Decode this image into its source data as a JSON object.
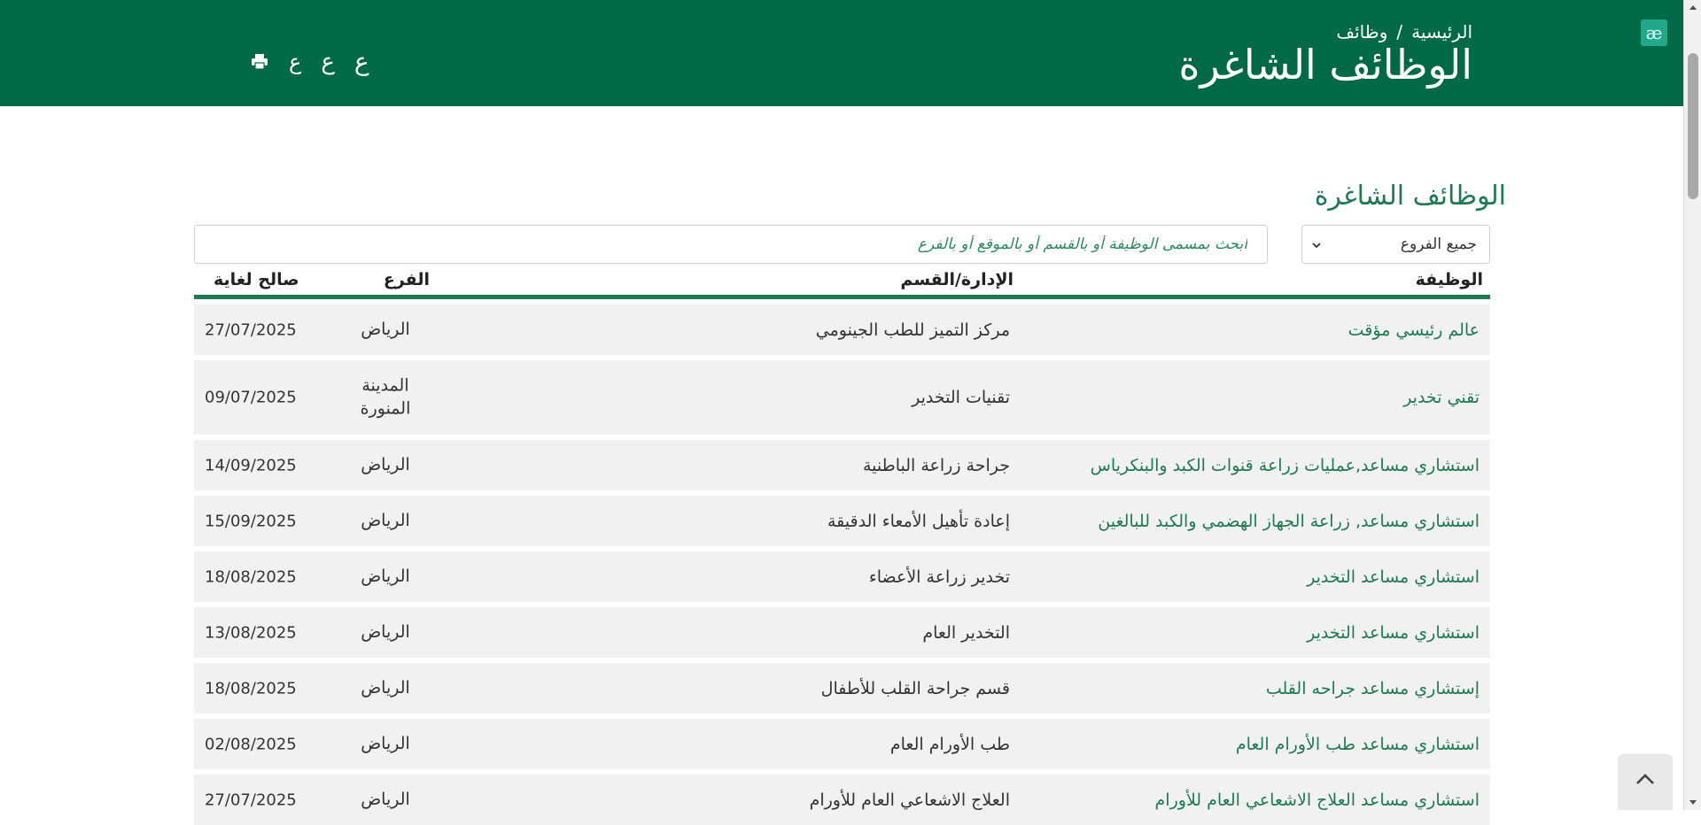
{
  "header": {
    "breadcrumb": {
      "home": "الرئيسية",
      "separator": "/",
      "current": "وظائف"
    },
    "title": "الوظائف الشاغرة",
    "accessibility_glyph": "æ",
    "font_controls": {
      "small": "ع",
      "medium": "ع",
      "large": "ع"
    },
    "bg_color": "#006a47"
  },
  "main": {
    "section_title": "الوظائف الشاغرة",
    "filters": {
      "branch_selected": "جميع الفروع",
      "search_placeholder": "ابحث بمسمى الوظيفة أو بالقسم أو بالموقع أو بالفرع"
    },
    "table": {
      "headers": {
        "job": "الوظيفة",
        "department": "الإدارة/القسم",
        "branch": "الفرع",
        "valid_until": "صالح لغاية"
      },
      "rows": [
        {
          "job": "عالم رئيسي مؤقت",
          "department": "مركز التميز للطب الجينومي",
          "branch": "الرياض",
          "valid_until": "27/07/2025"
        },
        {
          "job": "تقني تخدير",
          "department": "تقنيات التخدير",
          "branch": "المدينة المنورة",
          "valid_until": "09/07/2025"
        },
        {
          "job": "استشاري مساعد,عمليات زراعة قنوات الكبد والبنكرياس",
          "department": "جراحة زراعة الباطنية",
          "branch": "الرياض",
          "valid_until": "14/09/2025"
        },
        {
          "job": "استشاري مساعد, زراعة الجهاز الهضمي والكبد للبالغين",
          "department": "إعادة تأهيل الأمعاء الدقيقة",
          "branch": "الرياض",
          "valid_until": "15/09/2025"
        },
        {
          "job": "استشاري مساعد التخدير",
          "department": "تخدير زراعة الأعضاء",
          "branch": "الرياض",
          "valid_until": "18/08/2025"
        },
        {
          "job": "استشاري مساعد التخدير",
          "department": "التخدير العام",
          "branch": "الرياض",
          "valid_until": "13/08/2025"
        },
        {
          "job": "إستشاري مساعد جراحه القلب",
          "department": "قسم جراحة القلب للأطفال",
          "branch": "الرياض",
          "valid_until": "18/08/2025"
        },
        {
          "job": "استشاري مساعد طب الأورام العام",
          "department": "طب الأورام العام",
          "branch": "الرياض",
          "valid_until": "02/08/2025"
        },
        {
          "job": "استشاري مساعد العلاج الاشعاعي العام للأورام",
          "department": "العلاج الاشعاعي العام للأورام",
          "branch": "الرياض",
          "valid_until": "27/07/2025"
        }
      ]
    }
  },
  "colors": {
    "brand_green": "#006a47",
    "accent_green": "#1d7a52",
    "row_bg": "#f1f1f1"
  }
}
